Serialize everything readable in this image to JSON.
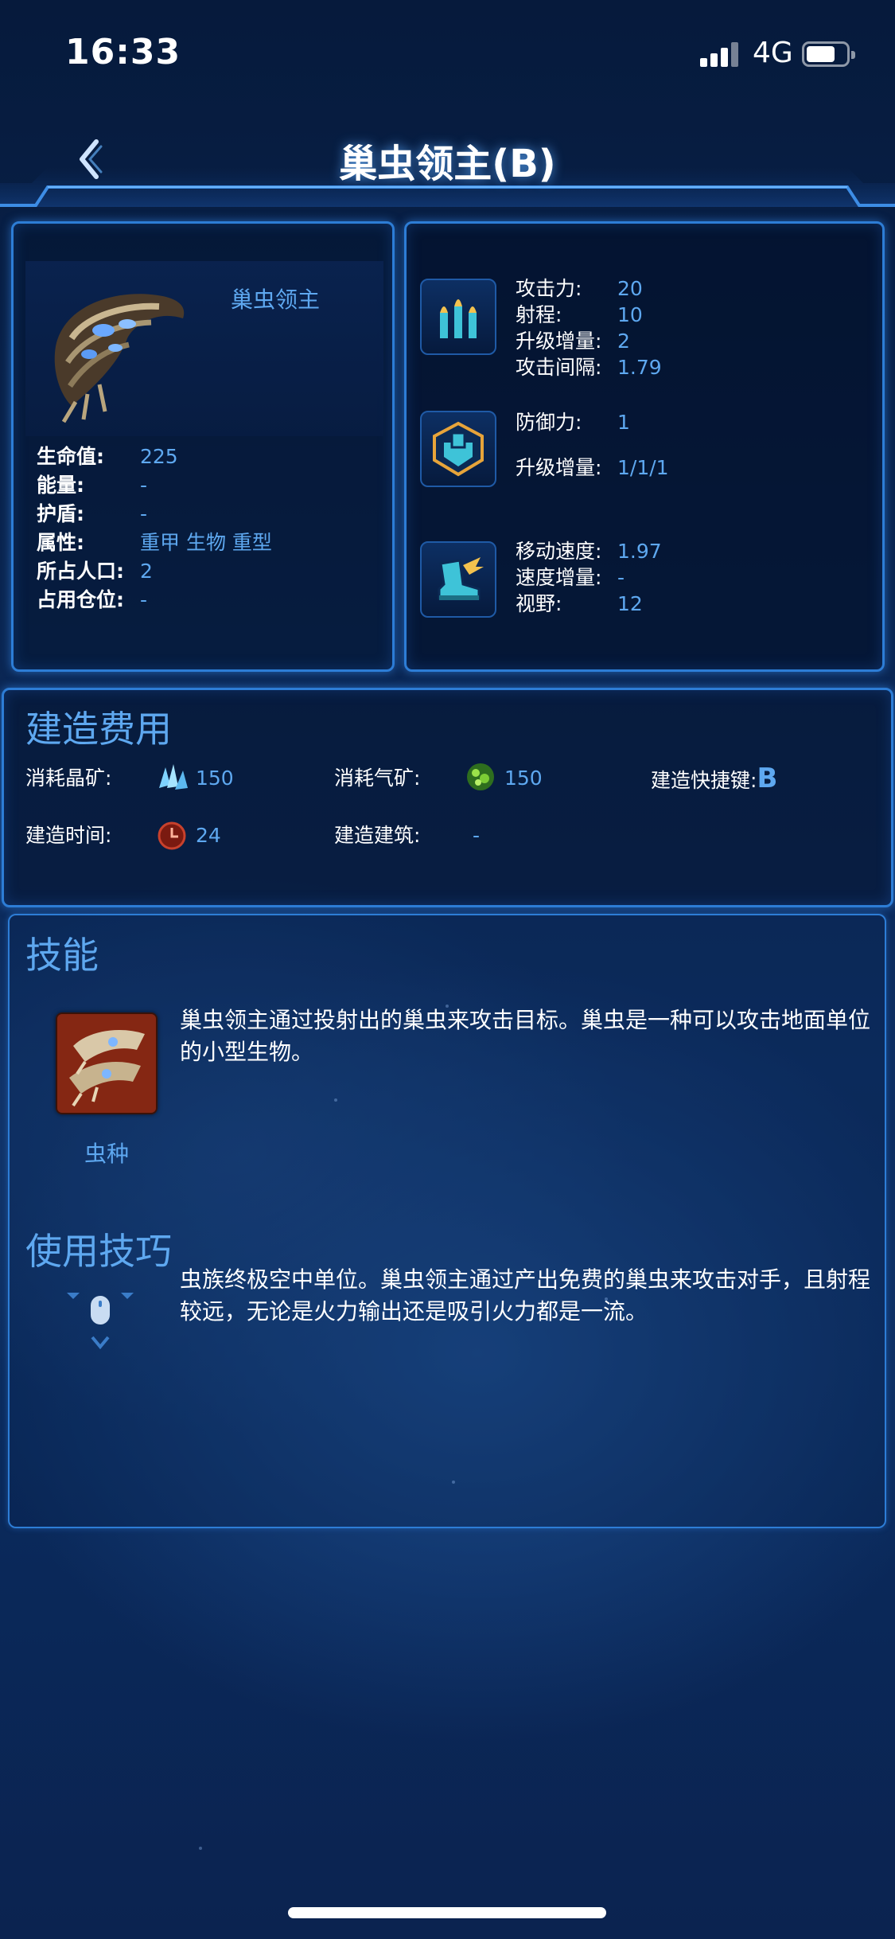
{
  "status_bar": {
    "time": "16:33",
    "network": "4G"
  },
  "nav": {
    "title": "巢虫领主(B)",
    "back_icon": "chevron-left-icon"
  },
  "unit": {
    "name": "巢虫领主",
    "stats": [
      {
        "label": "生命值:",
        "value": "225"
      },
      {
        "label": "能量:",
        "value": "-"
      },
      {
        "label": "护盾:",
        "value": "-"
      },
      {
        "label": "属性:",
        "value": "重甲 生物 重型"
      },
      {
        "label": "所占人口:",
        "value": "2"
      },
      {
        "label": "占用仓位:",
        "value": "-"
      }
    ]
  },
  "combat": {
    "attack": {
      "icon": "ammo-icon",
      "rows": [
        {
          "label": "攻击力:",
          "value": "20"
        },
        {
          "label": "射程:",
          "value": "10"
        },
        {
          "label": "升级增量:",
          "value": "2"
        },
        {
          "label": "攻击间隔:",
          "value": "1.79"
        }
      ]
    },
    "defense": {
      "icon": "armor-icon",
      "rows": [
        {
          "label": "防御力:",
          "value": "1"
        },
        {
          "label": "升级增量:",
          "value": "1/1/1"
        }
      ]
    },
    "movement": {
      "icon": "boot-icon",
      "rows": [
        {
          "label": "移动速度:",
          "value": "1.97"
        },
        {
          "label": "速度增量:",
          "value": "-"
        },
        {
          "label": "视野:",
          "value": "12"
        }
      ]
    }
  },
  "cost": {
    "title": "建造费用",
    "minerals_label": "消耗晶矿:",
    "minerals_value": "150",
    "gas_label": "消耗气矿:",
    "gas_value": "150",
    "hotkey_label": "建造快捷键:",
    "hotkey_value": "B",
    "time_label": "建造时间:",
    "time_value": "24",
    "building_label": "建造建筑:",
    "building_value": "-"
  },
  "skills": {
    "title": "技能",
    "items": [
      {
        "name": "虫种",
        "description": "巢虫领主通过投射出的巢虫来攻击目标。巢虫是一种可以攻击地面单位的小型生物。"
      }
    ]
  },
  "tips": {
    "title": "使用技巧",
    "text": "虫族终极空中单位。巢虫领主通过产出免费的巢虫来攻击对手，且射程较远，无论是火力输出还是吸引火力都是一流。"
  },
  "colors": {
    "accent": "#5ea8f0",
    "frame": "#2d7dd6",
    "background": "#0a2550"
  }
}
